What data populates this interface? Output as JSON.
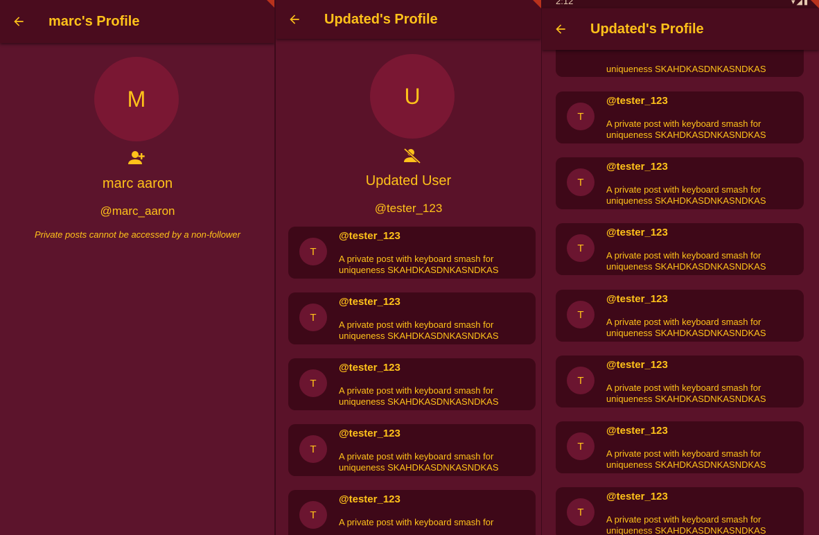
{
  "colors": {
    "accent": "#ffc21a",
    "background": "#5a1229",
    "appbar": "#4a0c1e",
    "card": "#3e0818",
    "avatar": "#7a1733"
  },
  "left": {
    "title": "marc's Profile",
    "avatar_letter": "M",
    "follow_icon": "person-add-icon",
    "name": "marc aaron",
    "handle": "@marc_aaron",
    "note": "Private posts cannot be accessed by a non-follower"
  },
  "middle": {
    "title": "Updated's Profile",
    "avatar_letter": "U",
    "follow_icon": "person-off-icon",
    "name": "Updated User",
    "handle": "@tester_123",
    "posts": [
      {
        "avatar": "T",
        "user": "@tester_123",
        "text": "A private post with keyboard smash for uniqueness SKAHDKASDNKASNDKAS"
      },
      {
        "avatar": "T",
        "user": "@tester_123",
        "text": "A private post with keyboard smash for uniqueness SKAHDKASDNKASNDKAS"
      },
      {
        "avatar": "T",
        "user": "@tester_123",
        "text": "A private post with keyboard smash for uniqueness SKAHDKASDNKASNDKAS"
      },
      {
        "avatar": "T",
        "user": "@tester_123",
        "text": "A private post with keyboard smash for uniqueness SKAHDKASDNKASNDKAS"
      },
      {
        "avatar": "T",
        "user": "@tester_123",
        "text": "A private post with keyboard smash for"
      }
    ]
  },
  "right": {
    "status_time": "2:12",
    "title": "Updated's Profile",
    "top_partial_text": "uniqueness SKAHDKASDNKASNDKAS",
    "posts": [
      {
        "avatar": "T",
        "user": "@tester_123",
        "text": "A private post with keyboard smash for uniqueness SKAHDKASDNKASNDKAS"
      },
      {
        "avatar": "T",
        "user": "@tester_123",
        "text": "A private post with keyboard smash for uniqueness SKAHDKASDNKASNDKAS"
      },
      {
        "avatar": "T",
        "user": "@tester_123",
        "text": "A private post with keyboard smash for uniqueness SKAHDKASDNKASNDKAS"
      },
      {
        "avatar": "T",
        "user": "@tester_123",
        "text": "A private post with keyboard smash for uniqueness SKAHDKASDNKASNDKAS"
      },
      {
        "avatar": "T",
        "user": "@tester_123",
        "text": "A private post with keyboard smash for uniqueness SKAHDKASDNKASNDKAS"
      },
      {
        "avatar": "T",
        "user": "@tester_123",
        "text": "A private post with keyboard smash for uniqueness SKAHDKASDNKASNDKAS"
      },
      {
        "avatar": "T",
        "user": "@tester_123",
        "text": "A private post with keyboard smash for uniqueness SKAHDKASDNKASNDKAS"
      }
    ]
  }
}
